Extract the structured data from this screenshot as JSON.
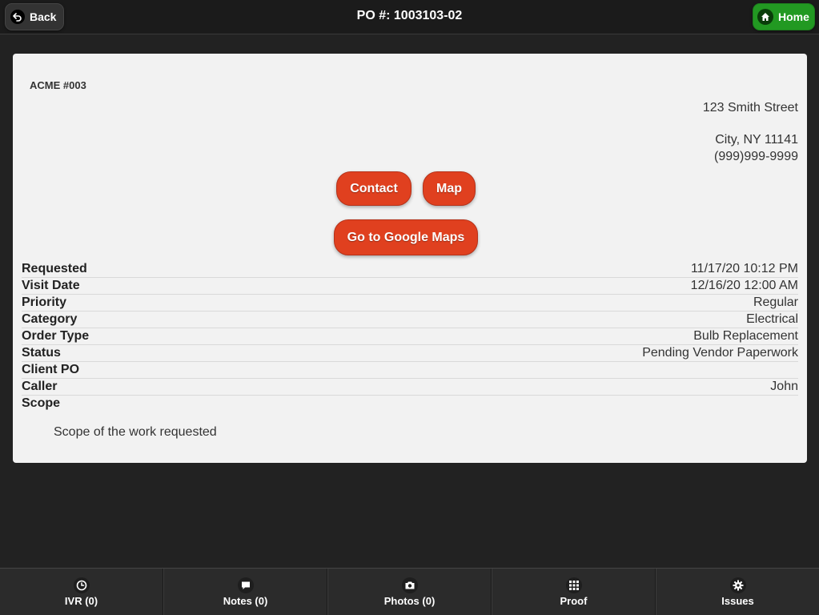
{
  "header": {
    "back_label": "Back",
    "title": "PO #: 1003103-02",
    "home_label": "Home"
  },
  "location": {
    "name": "ACME #003",
    "street": "123 Smith Street",
    "city_state_zip": "City, NY 11141",
    "phone": "(999)999-9999"
  },
  "actions": {
    "contact_label": "Contact",
    "map_label": "Map",
    "google_maps_label": "Go to Google Maps"
  },
  "details": {
    "rows": [
      {
        "label": "Requested",
        "value": "11/17/20 10:12 PM"
      },
      {
        "label": "Visit Date",
        "value": "12/16/20 12:00 AM"
      },
      {
        "label": "Priority",
        "value": "Regular"
      },
      {
        "label": "Category",
        "value": "Electrical"
      },
      {
        "label": "Order Type",
        "value": "Bulb Replacement"
      },
      {
        "label": "Status",
        "value": "Pending Vendor Paperwork"
      },
      {
        "label": "Client PO",
        "value": ""
      },
      {
        "label": "Caller",
        "value": "John"
      },
      {
        "label": "Scope",
        "value": ""
      }
    ],
    "scope_text": "Scope of the work requested"
  },
  "footer": {
    "items": [
      {
        "label": "IVR (0)",
        "icon": "clock-icon"
      },
      {
        "label": "Notes (0)",
        "icon": "comment-icon"
      },
      {
        "label": "Photos (0)",
        "icon": "camera-icon"
      },
      {
        "label": "Proof",
        "icon": "grid-icon"
      },
      {
        "label": "Issues",
        "icon": "gear-icon"
      }
    ]
  },
  "colors": {
    "accent_red": "#e0401f",
    "home_green": "#229922",
    "background": "#222222",
    "card": "#f2f2f2"
  }
}
